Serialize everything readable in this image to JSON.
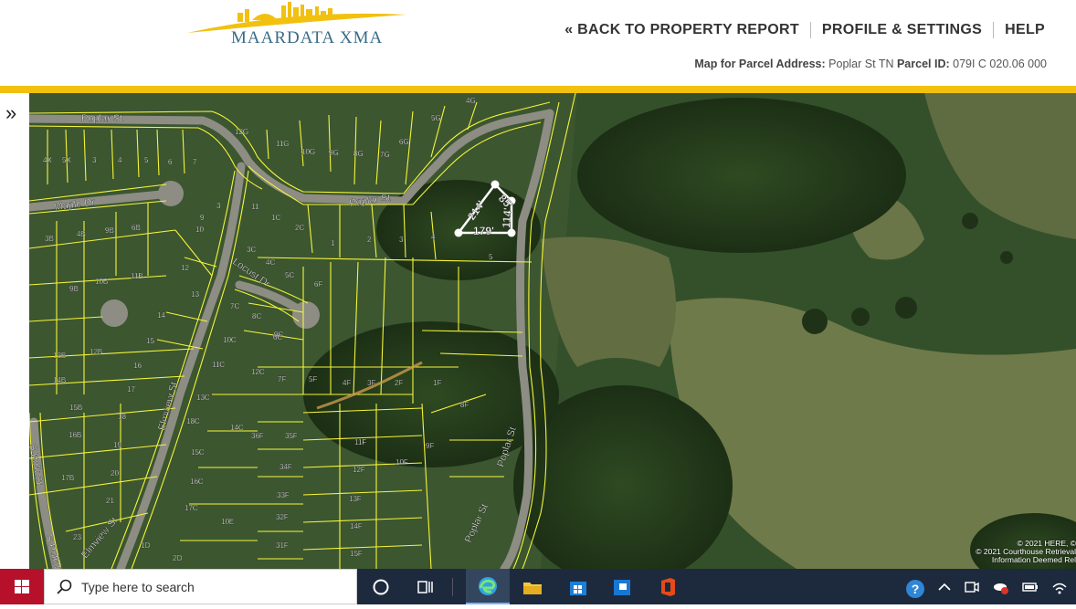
{
  "header": {
    "logo_text": "MAARDATA XMA",
    "nav": [
      {
        "label": "« BACK TO PROPERTY REPORT"
      },
      {
        "label": "PROFILE & SETTINGS"
      },
      {
        "label": "HELP"
      }
    ],
    "parcel": {
      "address_label": "Map for Parcel Address:",
      "address_value": "Poplar St TN",
      "id_label": "Parcel ID:",
      "id_value": "079I C 020.06 000"
    }
  },
  "side_toggle": "»",
  "map": {
    "streets": [
      "Poplar St",
      "Poplar St",
      "Maple Dr",
      "Locust Dr",
      "Elmview St",
      "S Polk St",
      "S Polk St",
      "Poplar St",
      "Poplar St",
      "Elmview St"
    ],
    "measurements": [
      "85'",
      "214'",
      "114'",
      "179'"
    ],
    "lot_labels": [
      "4X",
      "5X",
      "3",
      "4",
      "5",
      "6",
      "7",
      "12G",
      "11G",
      "10G",
      "9G",
      "8G",
      "7G",
      "6G",
      "5G",
      "4G",
      "3B",
      "4B",
      "9B",
      "6B",
      "3",
      "10",
      "9",
      "11",
      "1C",
      "2C",
      "3C",
      "4C",
      "5C",
      "1",
      "2",
      "3",
      "4",
      "5",
      "10B",
      "11B",
      "12",
      "13",
      "9B",
      "8C",
      "6C",
      "6F",
      "7C",
      "14",
      "13B",
      "12B",
      "15",
      "10C",
      "9C",
      "16",
      "11C",
      "12C",
      "7F",
      "5F",
      "4F",
      "3F",
      "2F",
      "1F",
      "14B",
      "17",
      "13C",
      "15B",
      "18",
      "14C",
      "16B",
      "19",
      "18C",
      "36F",
      "35F",
      "11F",
      "9F",
      "8F",
      "15C",
      "17B",
      "20",
      "16C",
      "34F",
      "12F",
      "10F",
      "21",
      "17C",
      "33F",
      "13F",
      "23",
      "10E",
      "32F",
      "14F",
      "1D",
      "2D",
      "31F",
      "15F"
    ],
    "attribution": [
      "© 2021 HERE, ©",
      "© 2021 Courthouse Retrieval",
      "Information Deemed Rel"
    ]
  },
  "taskbar": {
    "search_placeholder": "Type here to search"
  },
  "colors": {
    "accent_gold": "#f2c00f",
    "logo_blue": "#3a6b86",
    "parcel_lines": "#f5f53a"
  }
}
